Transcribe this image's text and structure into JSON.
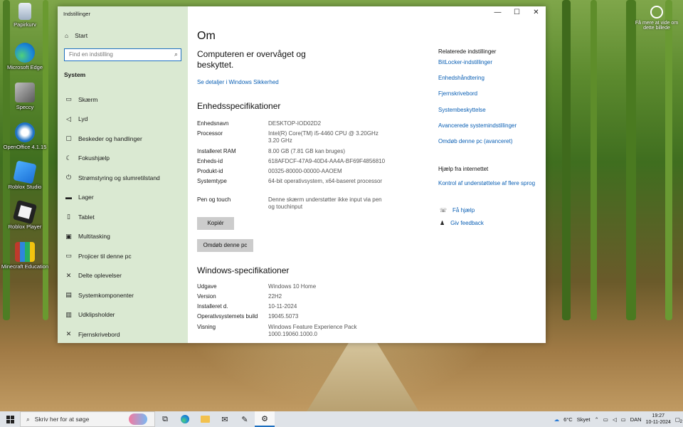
{
  "desktop": {
    "icons": [
      {
        "label": "Papirkurv",
        "icon": "recycle-bin-icon"
      },
      {
        "label": "Microsoft Edge",
        "icon": "edge-icon"
      },
      {
        "label": "Speccy",
        "icon": "speccy-icon"
      },
      {
        "label": "OpenOffice 4.1.15",
        "icon": "openoffice-icon"
      },
      {
        "label": "Roblox Studio",
        "icon": "roblox-studio-icon"
      },
      {
        "label": "Roblox Player",
        "icon": "roblox-player-icon"
      },
      {
        "label": "Minecraft Education",
        "icon": "minecraft-education-icon"
      }
    ],
    "spotlight_text": "Få mere at vide om dette billede"
  },
  "window": {
    "title": "Indstillinger",
    "controls": {
      "minimize": "—",
      "maximize": "☐",
      "close": "✕"
    }
  },
  "sidebar": {
    "home": "Start",
    "search_placeholder": "Find en indstilling",
    "section": "System",
    "items": [
      {
        "label": "Skærm",
        "icon": "monitor-icon"
      },
      {
        "label": "Lyd",
        "icon": "speaker-icon"
      },
      {
        "label": "Beskeder og handlinger",
        "icon": "notification-icon"
      },
      {
        "label": "Fokushjælp",
        "icon": "moon-icon"
      },
      {
        "label": "Strømstyring og slumretilstand",
        "icon": "power-icon"
      },
      {
        "label": "Lager",
        "icon": "storage-icon"
      },
      {
        "label": "Tablet",
        "icon": "tablet-icon"
      },
      {
        "label": "Multitasking",
        "icon": "multitasking-icon"
      },
      {
        "label": "Projicer til denne pc",
        "icon": "project-icon"
      },
      {
        "label": "Delte oplevelser",
        "icon": "shared-icon"
      },
      {
        "label": "Systemkomponenter",
        "icon": "components-icon"
      },
      {
        "label": "Udklipsholder",
        "icon": "clipboard-icon"
      },
      {
        "label": "Fjernskrivebord",
        "icon": "remote-icon"
      }
    ]
  },
  "main": {
    "heading": "Om",
    "protected_text": "Computeren er overvåget og beskyttet.",
    "security_link": "Se detaljer i Windows Sikkerhed",
    "device_specs_title": "Enhedsspecifikationer",
    "device_specs": [
      {
        "key": "Enhedsnavn",
        "value": "DESKTOP-IOD02D2"
      },
      {
        "key": "Processor",
        "value": "Intel(R) Core(TM) i5-4460  CPU @ 3.20GHz 3.20 GHz"
      },
      {
        "key": "Installeret RAM",
        "value": "8.00 GB (7.81 GB kan bruges)"
      },
      {
        "key": "Enheds-id",
        "value": "618AFDCF-47A9-40D4-AA4A-BF69F4856810"
      },
      {
        "key": "Produkt-id",
        "value": "00325-80000-00000-AAOEM"
      },
      {
        "key": "Systemtype",
        "value": "64-bit operativsystem, x64-baseret processor"
      },
      {
        "key": "Pen og touch",
        "value": "Denne skærm understøtter ikke input via pen og touchinput"
      }
    ],
    "copy_button": "Kopiér",
    "rename_button": "Omdøb denne pc",
    "windows_specs_title": "Windows-specifikationer",
    "windows_specs": [
      {
        "key": "Udgave",
        "value": "Windows 10 Home"
      },
      {
        "key": "Version",
        "value": "22H2"
      },
      {
        "key": "Installeret d.",
        "value": "10-11-2024"
      },
      {
        "key": "Operativsystemets build",
        "value": "19045.5073"
      },
      {
        "key": "Visning",
        "value": "Windows Feature Experience Pack 1000.19060.1000.0"
      }
    ]
  },
  "related": {
    "title": "Relaterede indstillinger",
    "links": [
      "BitLocker-indstillinger",
      "Enhedshåndtering",
      "Fjernskrivebord",
      "Systembeskyttelse",
      "Avancerede systemindstillinger",
      "Omdøb denne pc (avanceret)"
    ],
    "help_title": "Hjælp fra internettet",
    "help_link": "Kontrol af understøttelse af flere sprog",
    "get_help": "Få hjælp",
    "feedback": "Giv feedback"
  },
  "taskbar": {
    "search_placeholder": "Skriv her for at søge",
    "weather_temp": "6°C",
    "weather_desc": "Skyet",
    "language": "DAN",
    "time": "19:27",
    "date": "10-11-2024",
    "notification_count": "2"
  }
}
